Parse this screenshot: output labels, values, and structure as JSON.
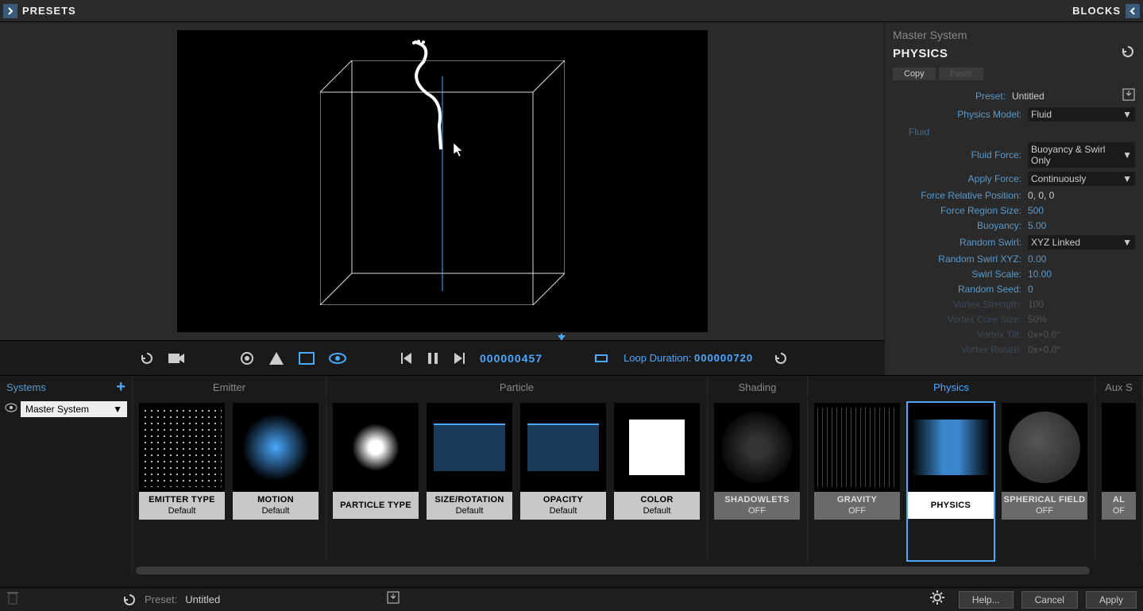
{
  "topbar": {
    "presets": "PRESETS",
    "blocks": "BLOCKS"
  },
  "props": {
    "system_title": "Master System",
    "heading": "PHYSICS",
    "copy": "Copy",
    "paste": "Paste",
    "preset_label": "Preset:",
    "preset_value": "Untitled",
    "model_label": "Physics Model:",
    "model_value": "Fluid",
    "section": "Fluid",
    "rows": {
      "fluid_force": {
        "label": "Fluid Force:",
        "value": "Buoyancy & Swirl Only"
      },
      "apply_force": {
        "label": "Apply Force:",
        "value": "Continuously"
      },
      "rel_pos": {
        "label": "Force Relative Position:",
        "value": "0, 0, 0"
      },
      "region": {
        "label": "Force Region Size:",
        "value": "500"
      },
      "buoyancy": {
        "label": "Buoyancy:",
        "value": "5.00"
      },
      "rswirl": {
        "label": "Random Swirl:",
        "value": "XYZ Linked"
      },
      "rswirlxyz": {
        "label": "Random Swirl XYZ:",
        "value": "0.00"
      },
      "sscale": {
        "label": "Swirl Scale:",
        "value": "10.00"
      },
      "rseed": {
        "label": "Random Seed:",
        "value": "0"
      },
      "vstrength": {
        "label": "Vortex Strength:",
        "value": "100"
      },
      "vcore": {
        "label": "Vortex Core Size:",
        "value": "50%"
      },
      "vtilt": {
        "label": "Vortex Tilt:",
        "value": "0x+0.0°"
      },
      "vrot": {
        "label": "Vortex Rotate:",
        "value": "0x+0.0°"
      }
    }
  },
  "playbar": {
    "frame": "000000457",
    "loop_label": "Loop Duration:",
    "loop_value": "000000720"
  },
  "systems": {
    "head": "Systems",
    "selected": "Master System"
  },
  "block_headers": {
    "emitter": "Emitter",
    "particle": "Particle",
    "shading": "Shading",
    "physics": "Physics",
    "aux": "Aux S"
  },
  "blocks": {
    "emitter_type": {
      "title": "EMITTER TYPE",
      "sub": "Default"
    },
    "motion": {
      "title": "MOTION",
      "sub": "Default"
    },
    "particle_type": {
      "title": "PARTICLE TYPE",
      "sub": ""
    },
    "size_rot": {
      "title": "SIZE/ROTATION",
      "sub": "Default"
    },
    "opacity": {
      "title": "OPACITY",
      "sub": "Default"
    },
    "color": {
      "title": "COLOR",
      "sub": "Default"
    },
    "shadowlets": {
      "title": "SHADOWLETS",
      "sub": "OFF"
    },
    "gravity": {
      "title": "GRAVITY",
      "sub": "OFF"
    },
    "physics": {
      "title": "PHYSICS",
      "sub": ""
    },
    "spherical": {
      "title": "SPHERICAL FIELD",
      "sub": "OFF"
    },
    "aux": {
      "title": "AL",
      "sub": "OF"
    }
  },
  "bottom": {
    "preset_label": "Preset:",
    "preset_value": "Untitled",
    "help": "Help...",
    "cancel": "Cancel",
    "apply": "Apply"
  }
}
